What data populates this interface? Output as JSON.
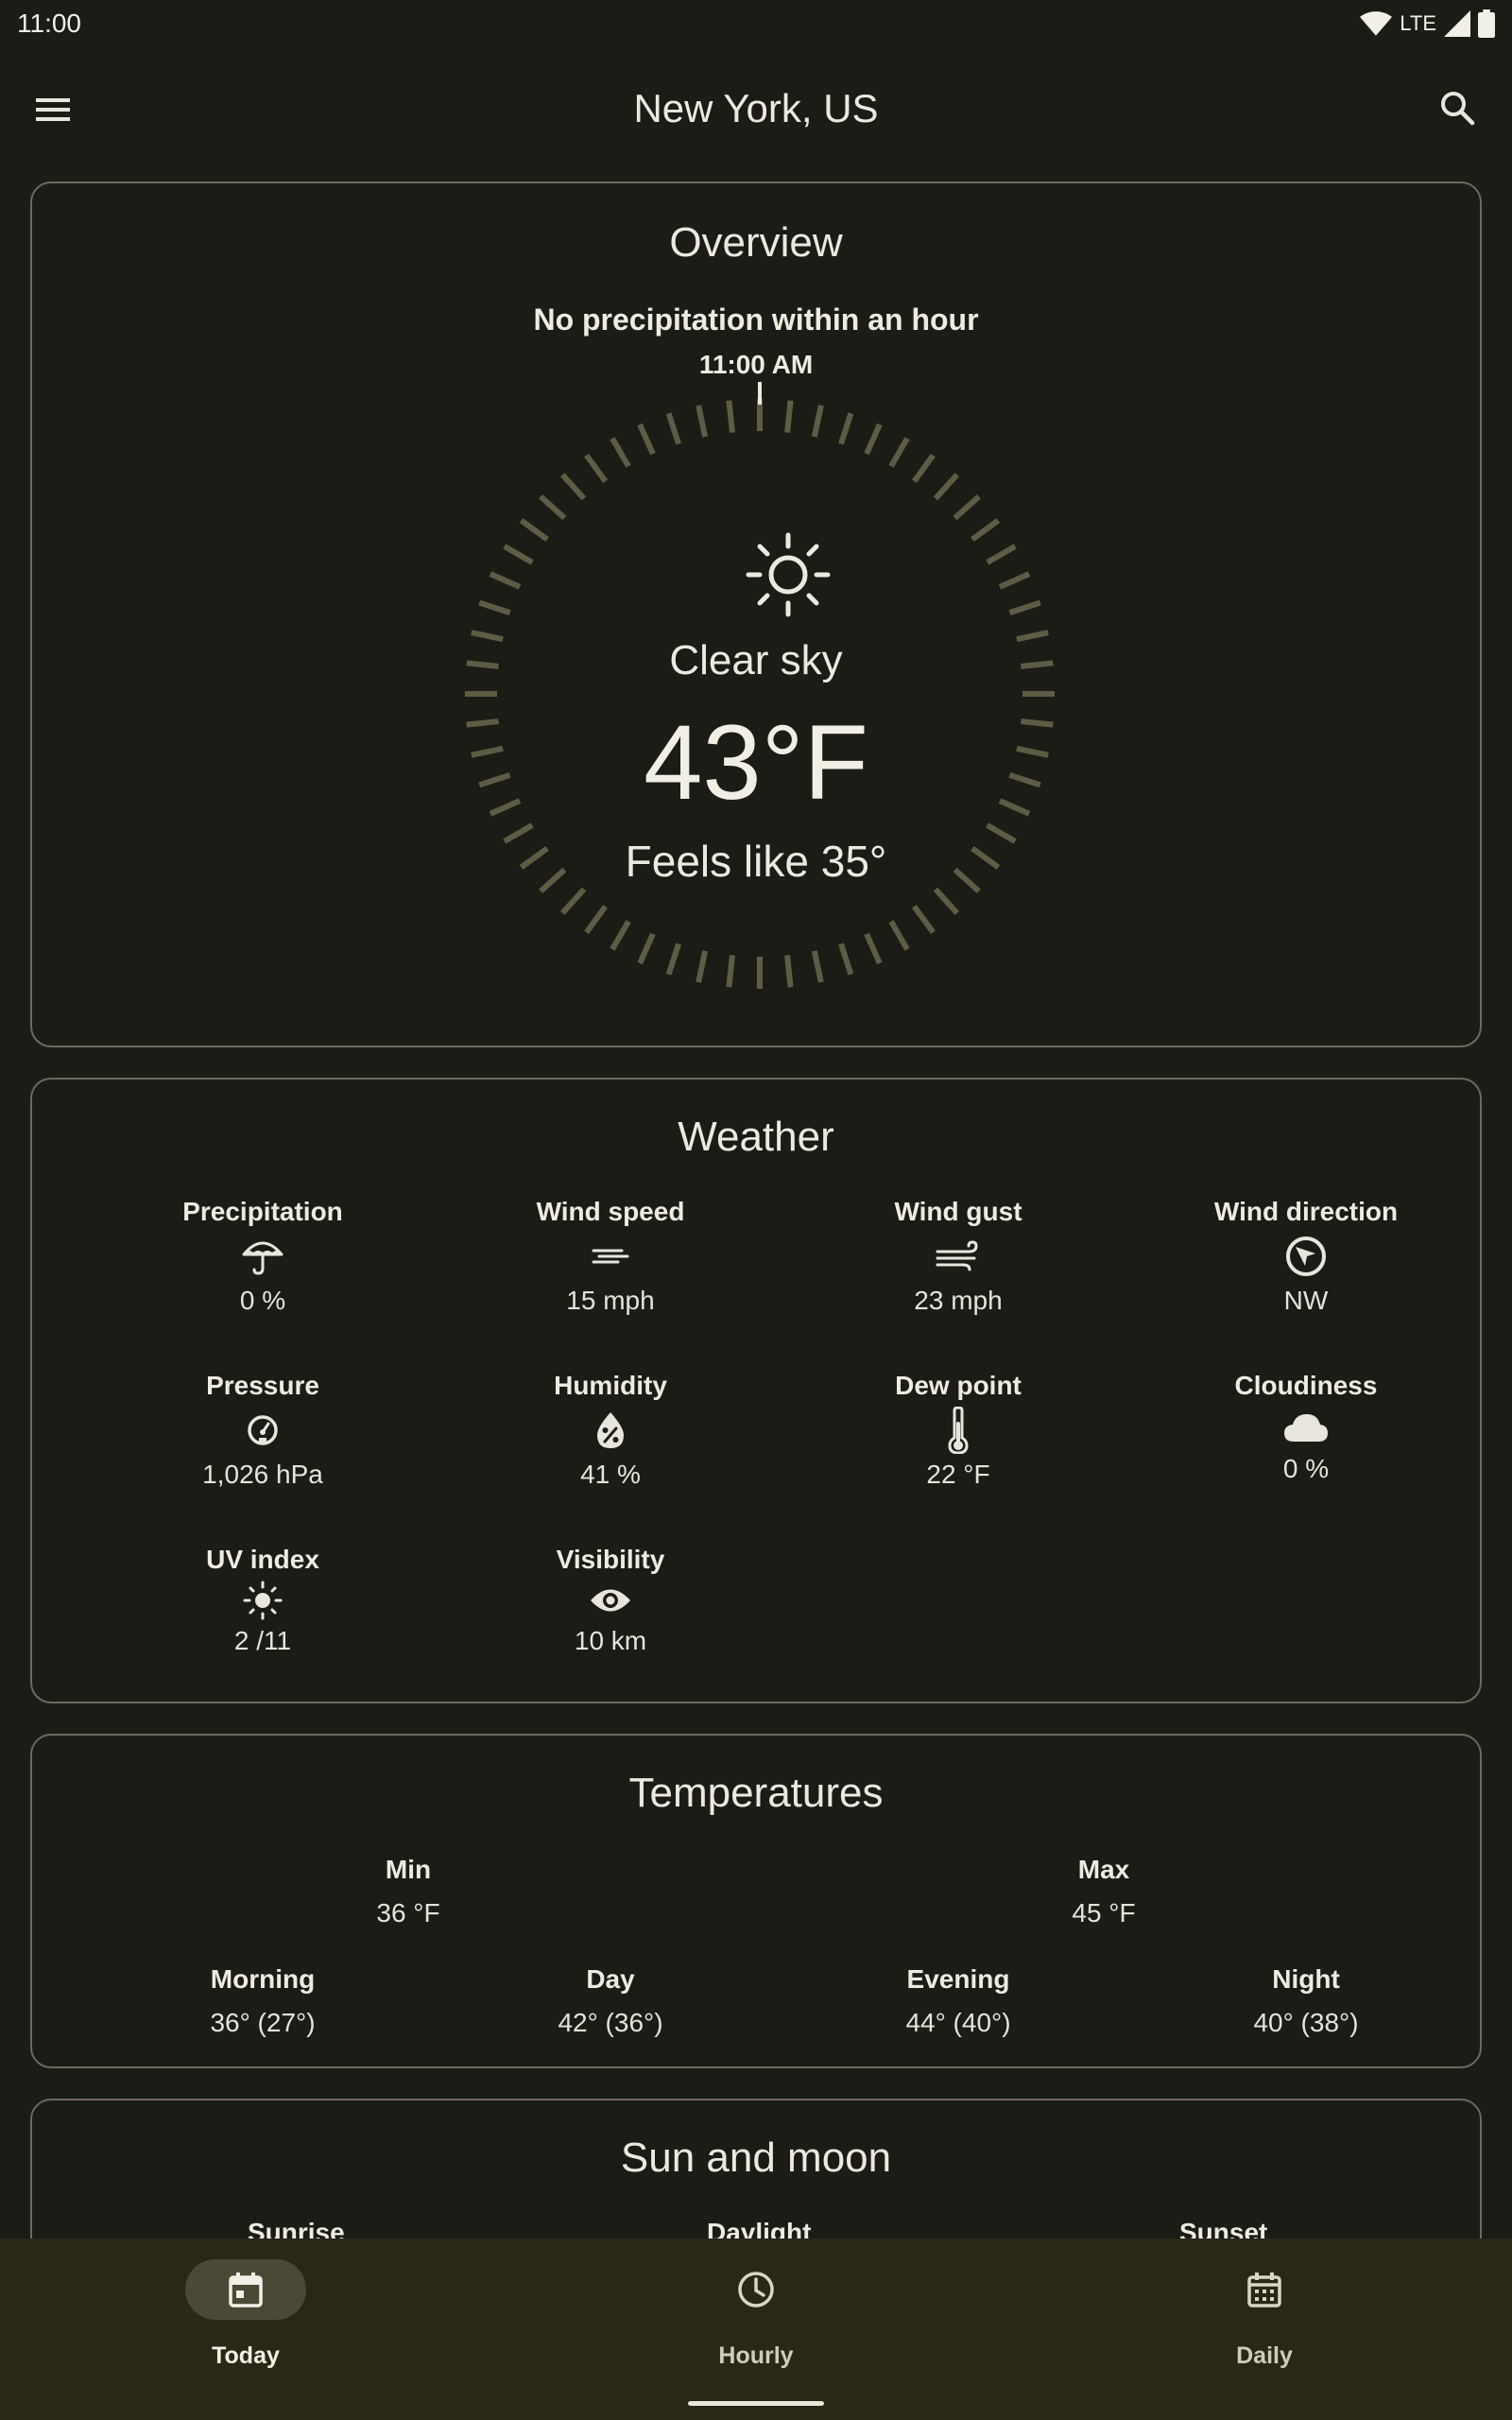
{
  "status_bar": {
    "time": "11:00",
    "network": "LTE"
  },
  "app_bar": {
    "title": "New York, US"
  },
  "overview": {
    "title": "Overview",
    "precipitation_note": "No precipitation within an hour",
    "time_label": "11:00 AM",
    "condition": "Clear sky",
    "temperature": "43°F",
    "feels_like": "Feels like 35°"
  },
  "weather": {
    "title": "Weather",
    "items": [
      {
        "label": "Precipitation",
        "value": "0 %",
        "icon": "umbrella-icon"
      },
      {
        "label": "Wind speed",
        "value": "15 mph",
        "icon": "wind-icon"
      },
      {
        "label": "Wind gust",
        "value": "23 mph",
        "icon": "wind-gust-icon"
      },
      {
        "label": "Wind direction",
        "value": "NW",
        "icon": "navigation-arrow-icon"
      },
      {
        "label": "Pressure",
        "value": "1,026 hPa",
        "icon": "gauge-icon"
      },
      {
        "label": "Humidity",
        "value": "41 %",
        "icon": "water-percent-icon"
      },
      {
        "label": "Dew point",
        "value": "22 °F",
        "icon": "thermometer-icon"
      },
      {
        "label": "Cloudiness",
        "value": "0 %",
        "icon": "cloud-icon"
      },
      {
        "label": "UV index",
        "value": "2 /11",
        "icon": "sun-icon"
      },
      {
        "label": "Visibility",
        "value": "10 km",
        "icon": "eye-icon"
      }
    ]
  },
  "temperatures": {
    "title": "Temperatures",
    "min": {
      "label": "Min",
      "value": "36 °F"
    },
    "max": {
      "label": "Max",
      "value": "45 °F"
    },
    "periods": [
      {
        "label": "Morning",
        "value": "36° (27°)"
      },
      {
        "label": "Day",
        "value": "42° (36°)"
      },
      {
        "label": "Evening",
        "value": "44° (40°)"
      },
      {
        "label": "Night",
        "value": "40° (38°)"
      }
    ]
  },
  "sun_and_moon": {
    "title": "Sun and moon",
    "labels": [
      "Sunrise",
      "Daylight",
      "Sunset"
    ]
  },
  "bottom_nav": {
    "items": [
      {
        "label": "Today",
        "active": true
      },
      {
        "label": "Hourly",
        "active": false
      },
      {
        "label": "Daily",
        "active": false
      }
    ]
  },
  "colors": {
    "background": "#1c1c17",
    "card_border": "#6d6a5f",
    "dial_tick": "#5f5c45",
    "nav_background": "#292817",
    "nav_active_pill": "#4a4936"
  }
}
